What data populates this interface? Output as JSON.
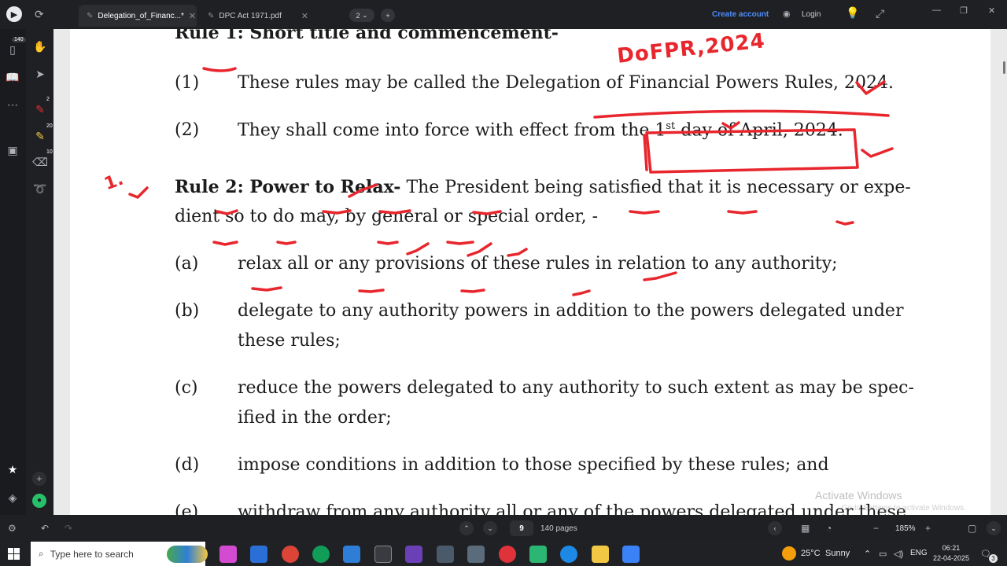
{
  "tabs": [
    {
      "label": "Delegation_of_Financ...*",
      "active": true
    },
    {
      "label": "DPC Act 1971.pdf",
      "active": false
    }
  ],
  "tab_count": "2",
  "header": {
    "create_account": "Create account",
    "login": "Login"
  },
  "sidebar": {
    "badge_pages": "140",
    "badge_pen": "2",
    "badge_highlight": "20",
    "badge_eraser": "10"
  },
  "document": {
    "heading_rule1": "Rule 1: Short title and commencement-",
    "annotation_top": "DoFPR,2024",
    "annotation_left": "1.",
    "r1_items": [
      {
        "num": "(1)",
        "text": "These rules may be called the Delegation of Financial Powers Rules, 2024."
      },
      {
        "num": "(2)",
        "text_before": "They shall come into force with effect from the ",
        "sup_base": "1",
        "sup": "st",
        "text_after": " day of April, 2024."
      }
    ],
    "rule2_title": "Rule 2: Power to Relax-",
    "rule2_line1": " The President being satisfied that it is necessary or expe-",
    "rule2_line2": "dient so to do may, by general or special order, -",
    "items": [
      {
        "num": "(a)",
        "lines": [
          "relax all or any provisions of these rules in relation to any authority;"
        ]
      },
      {
        "num": "(b)",
        "lines": [
          "delegate to any authority powers in addition to the powers delegated under",
          "these rules;"
        ]
      },
      {
        "num": "(c)",
        "lines": [
          "reduce the powers delegated to any authority to such extent as may be spec-",
          "ified in the order;"
        ]
      },
      {
        "num": "(d)",
        "lines": [
          "impose conditions in addition to those specified by these rules; and"
        ]
      },
      {
        "num": "(e)",
        "lines": [
          "withdraw from any authority all or any of the powers delegated under these"
        ]
      }
    ]
  },
  "watermark": {
    "line1": "Activate Windows",
    "line2": "Go to Settings to activate Windows."
  },
  "bottom": {
    "current_page": "9",
    "total_pages": "140 pages",
    "zoom": "185%"
  },
  "taskbar": {
    "search_placeholder": "Type here to search",
    "weather_temp": "25°C",
    "weather_desc": "Sunny",
    "lang": "ENG",
    "time": "06:21",
    "date": "22-04-2025",
    "notif_count": "3"
  }
}
